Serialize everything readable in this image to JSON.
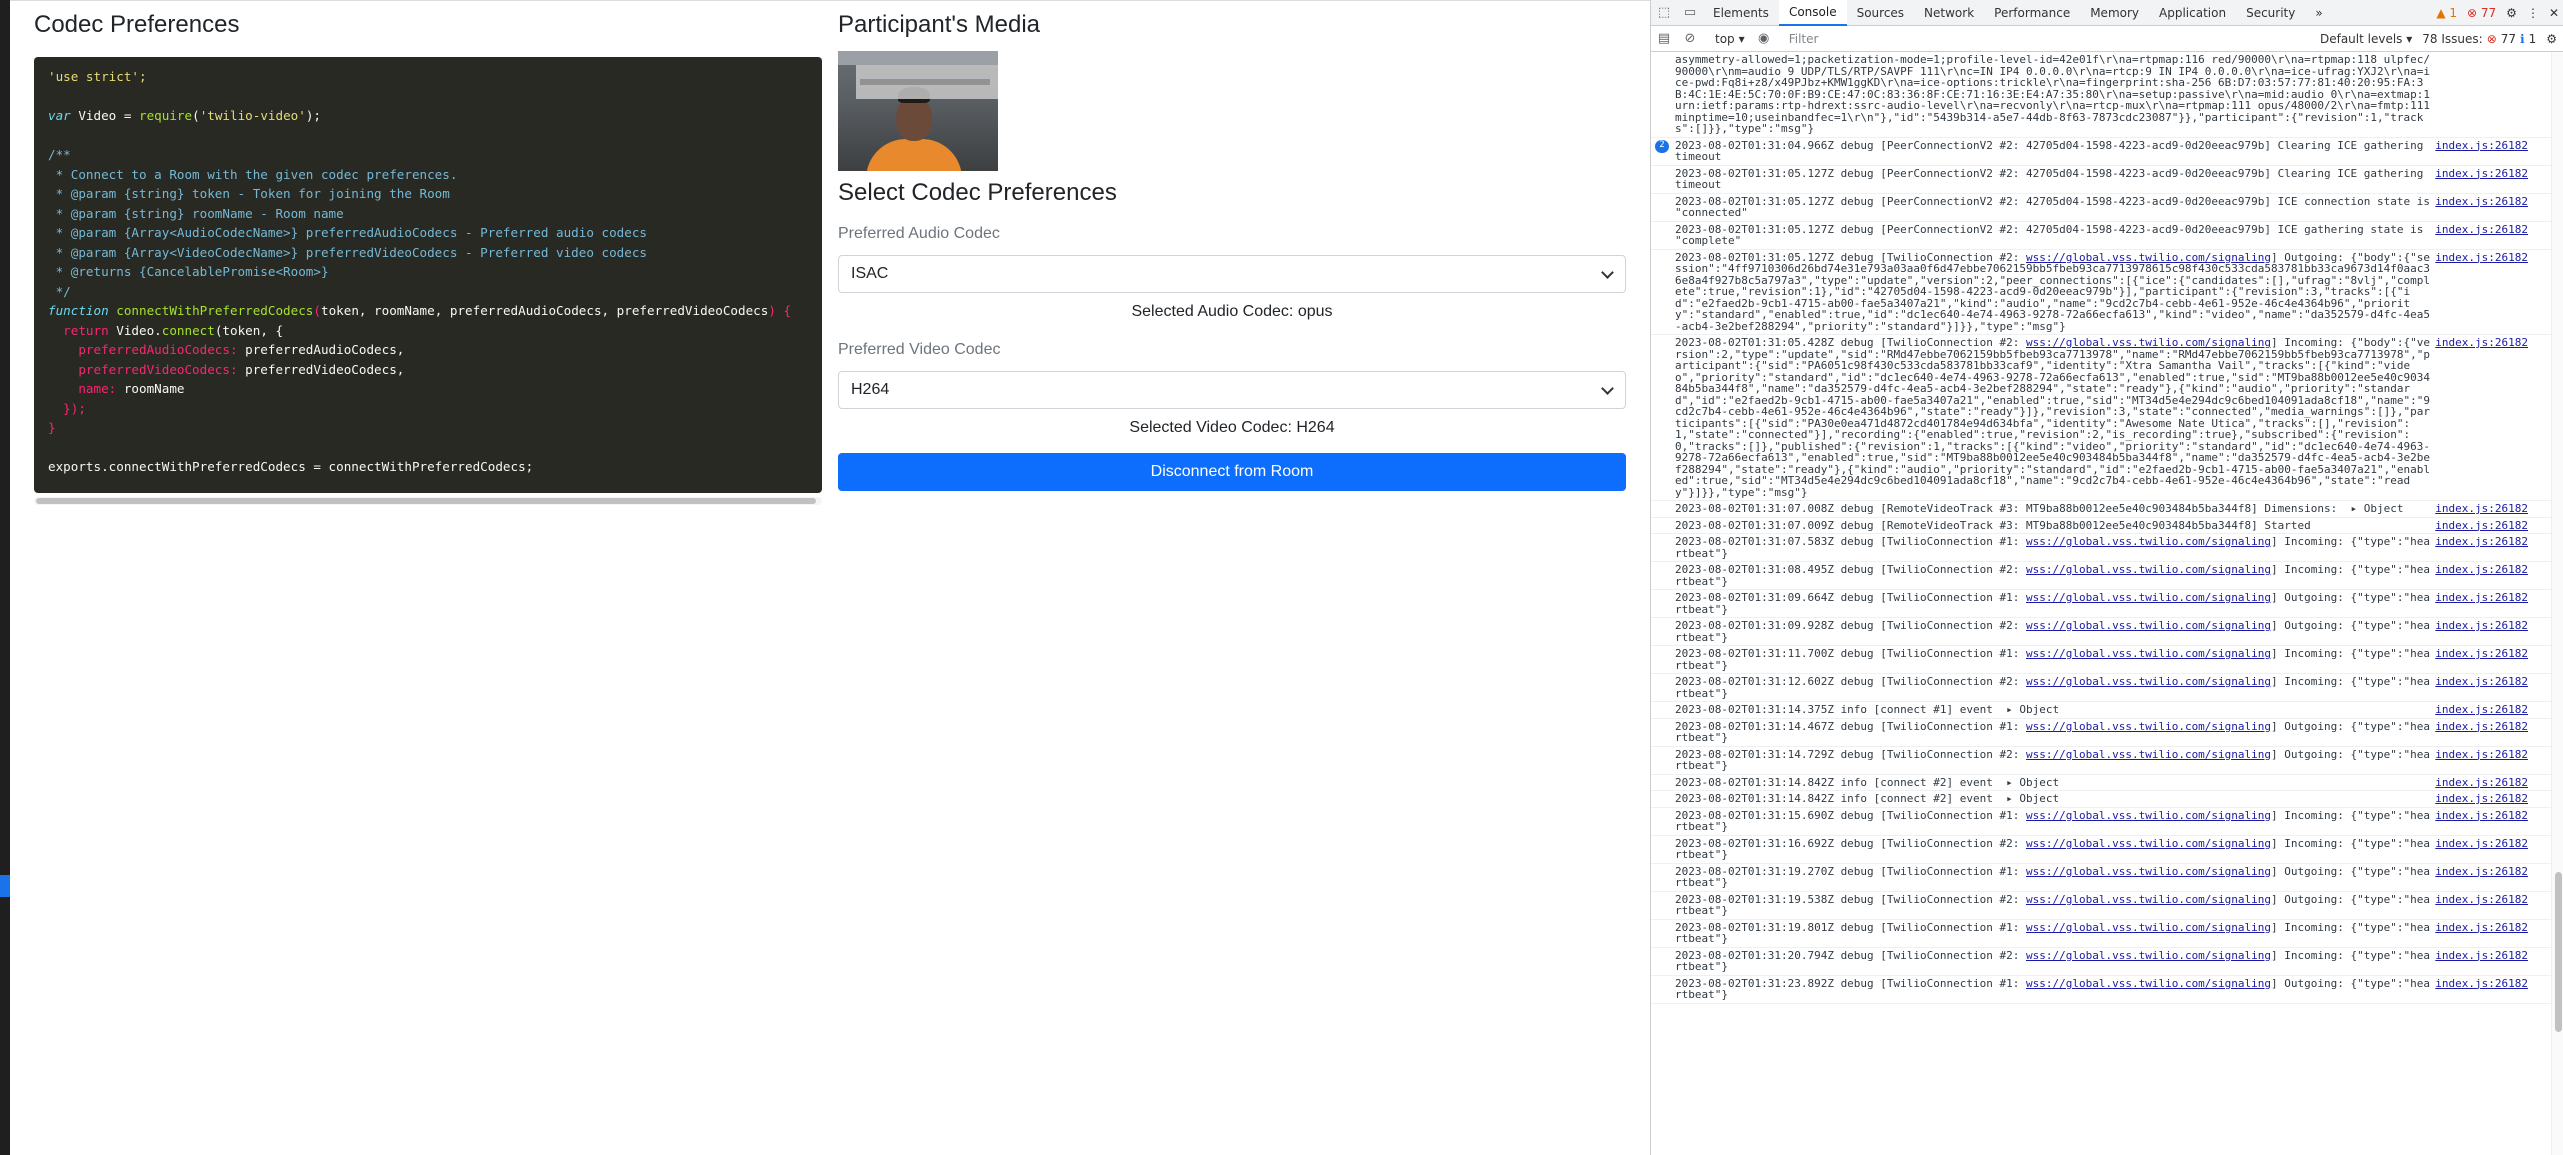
{
  "left_panel": {
    "title": "Codec Preferences",
    "code_lines": [
      [
        {
          "t": "'use strict';",
          "c": "str"
        }
      ],
      [],
      [
        {
          "t": "var ",
          "c": "kw"
        },
        {
          "t": "Video = ",
          "c": "id"
        },
        {
          "t": "require",
          "c": "fn"
        },
        {
          "t": "(",
          "c": "id"
        },
        {
          "t": "'twilio-video'",
          "c": "str"
        },
        {
          "t": ");",
          "c": "id"
        }
      ],
      [],
      [
        {
          "t": "/**",
          "c": "cm"
        }
      ],
      [
        {
          "t": " * Connect to a Room with the given codec preferences.",
          "c": "cm"
        }
      ],
      [
        {
          "t": " * @param {string} token - Token for joining the Room",
          "c": "cm"
        }
      ],
      [
        {
          "t": " * @param {string} roomName - Room name",
          "c": "cm"
        }
      ],
      [
        {
          "t": " * @param {Array<AudioCodecName>} preferredAudioCodecs - Preferred audio codecs",
          "c": "cm"
        }
      ],
      [
        {
          "t": " * @param {Array<VideoCodecName>} preferredVideoCodecs - Preferred video codecs",
          "c": "cm"
        }
      ],
      [
        {
          "t": " * @returns {CancelablePromise<Room>}",
          "c": "cm"
        }
      ],
      [
        {
          "t": " */",
          "c": "cm"
        }
      ],
      [
        {
          "t": "function ",
          "c": "kw"
        },
        {
          "t": "connectWithPreferredCodecs",
          "c": "fn"
        },
        {
          "t": "(",
          "c": "prop"
        },
        {
          "t": "token, roomName, preferredAudioCodecs, preferredVideoCodecs",
          "c": "id"
        },
        {
          "t": ") {",
          "c": "prop"
        }
      ],
      [
        {
          "t": "  return ",
          "c": "kw2"
        },
        {
          "t": "Video.",
          "c": "id"
        },
        {
          "t": "connect",
          "c": "fn"
        },
        {
          "t": "(token, {",
          "c": "id"
        }
      ],
      [
        {
          "t": "    preferredAudioCodecs: ",
          "c": "prop"
        },
        {
          "t": "preferredAudioCodecs,",
          "c": "id"
        }
      ],
      [
        {
          "t": "    preferredVideoCodecs: ",
          "c": "prop"
        },
        {
          "t": "preferredVideoCodecs,",
          "c": "id"
        }
      ],
      [
        {
          "t": "    name: ",
          "c": "prop"
        },
        {
          "t": "roomName",
          "c": "id"
        }
      ],
      [
        {
          "t": "  });",
          "c": "prop"
        }
      ],
      [
        {
          "t": "}",
          "c": "prop"
        }
      ],
      [],
      [
        {
          "t": "exports.connectWithPreferredCodecs = connectWithPreferredCodecs;",
          "c": "id"
        }
      ]
    ]
  },
  "right_panel": {
    "media_title": "Participant's Media",
    "codec_title": "Select Codec Preferences",
    "audio_label": "Preferred Audio Codec",
    "audio_value": "ISAC",
    "selected_audio": "Selected Audio Codec: opus",
    "video_label": "Preferred Video Codec",
    "video_value": "H264",
    "selected_video": "Selected Video Codec: H264",
    "disconnect_label": "Disconnect from Room"
  },
  "devtools": {
    "tabs": [
      "Elements",
      "Console",
      "Sources",
      "Network",
      "Performance",
      "Memory",
      "Application",
      "Security"
    ],
    "active_tab": "Console",
    "more_tabs": "»",
    "warnings_count": "1",
    "errors_count": "77",
    "context": "top",
    "filter_placeholder": "Filter",
    "levels": "Default levels",
    "issues_label": "78 Issues:",
    "issues_errors": "77",
    "issues_info": "1",
    "messages": [
      {
        "text": "asymmetry-allowed=1;packetization-mode=1;profile-level-id=42e01f\\r\\na=rtpmap:116 red/90000\\r\\na=rtpmap:118 ulpfec/90000\\r\\nm=audio 9 UDP/TLS/RTP/SAVPF 111\\r\\nc=IN IP4 0.0.0.0\\r\\na=rtcp:9 IN IP4 0.0.0.0\\r\\na=ice-ufrag:YXJ2\\r\\na=ice-pwd:Fq8i+z8/x49PJbz+KMW1ggKD\\r\\na=ice-options:trickle\\r\\na=fingerprint:sha-256 6B:D7:03:57:77:81:40:20:95:FA:3B:4C:1E:4E:5C:70:0F:B9:CE:47:0C:83:36:8F:CE:71:16:3E:E4:A7:35:80\\r\\na=setup:passive\\r\\na=mid:audio 0\\r\\na=extmap:1 urn:ietf:params:rtp-hdrext:ssrc-audio-level\\r\\na=recvonly\\r\\na=rtcp-mux\\r\\na=rtpmap:111 opus/48000/2\\r\\na=fmtp:111 minptime=10;useinbandfec=1\\r\\n\"},\"id\":\"5439b314-a5e7-44db-8f63-7873cdc23087\"}},\"participant\":{\"revision\":1,\"tracks\":[]}},\"type\":\"msg\"}",
        "src": ""
      },
      {
        "badge": "2",
        "text": "2023-08-02T01:31:04.966Z debug [PeerConnectionV2 #2: 42705d04-1598-4223-acd9-0d20eeac979b] Clearing ICE gathering timeout",
        "src": "index.js:26182"
      },
      {
        "text": "2023-08-02T01:31:05.127Z debug [PeerConnectionV2 #2: 42705d04-1598-4223-acd9-0d20eeac979b] Clearing ICE gathering timeout",
        "src": "index.js:26182"
      },
      {
        "text": "2023-08-02T01:31:05.127Z debug [PeerConnectionV2 #2: 42705d04-1598-4223-acd9-0d20eeac979b] ICE connection state is \"connected\"",
        "src": "index.js:26182"
      },
      {
        "text": "2023-08-02T01:31:05.127Z debug [PeerConnectionV2 #2: 42705d04-1598-4223-acd9-0d20eeac979b] ICE gathering state is \"complete\"",
        "src": "index.js:26182"
      },
      {
        "pre": "2023-08-02T01:31:05.127Z debug [TwilioConnection #2: ",
        "link": "wss://global.vss.twilio.com/signaling",
        "text": "] Outgoing: {\"body\":{\"session\":\"4ff9710306d26bd74e31e793a03aa0f6d47ebbe7062159bb5fbeb93ca7713978615c98f430c533cda583781bb33ca9673d14f0aac36e8a4f927b8c5a797a3\",\"type\":\"update\",\"version\":2,\"peer_connections\":[{\"ice\":{\"candidates\":[],\"ufrag\":\"8vlj\",\"complete\":true,\"revision\":1},\"id\":\"42705d04-1598-4223-acd9-0d20eeac979b\"}],\"participant\":{\"revision\":3,\"tracks\":[{\"id\":\"e2faed2b-9cb1-4715-ab00-fae5a3407a21\",\"kind\":\"audio\",\"name\":\"9cd2c7b4-cebb-4e61-952e-46c4e4364b96\",\"priority\":\"standard\",\"enabled\":true,\"id\":\"dc1ec640-4e74-4963-9278-72a66ecfa613\",\"kind\":\"video\",\"name\":\"da352579-d4fc-4ea5-acb4-3e2bef288294\",\"priority\":\"standard\"}]}},\"type\":\"msg\"}",
        "src": "index.js:26182"
      },
      {
        "pre": "2023-08-02T01:31:05.428Z debug [TwilioConnection #2: ",
        "link": "wss://global.vss.twilio.com/signaling",
        "text": "] Incoming: {\"body\":{\"version\":2,\"type\":\"update\",\"sid\":\"RMd47ebbe7062159bb5fbeb93ca7713978\",\"name\":\"RMd47ebbe7062159bb5fbeb93ca7713978\",\"participant\":{\"sid\":\"PA6051c98f430c533cda583781bb33caf9\",\"identity\":\"Xtra Samantha Vail\",\"tracks\":[{\"kind\":\"video\",\"priority\":\"standard\",\"id\":\"dc1ec640-4e74-4963-9278-72a66ecfa613\",\"enabled\":true,\"sid\":\"MT9ba88b0012ee5e40c903484b5ba344f8\",\"name\":\"da352579-d4fc-4ea5-acb4-3e2bef288294\",\"state\":\"ready\"},{\"kind\":\"audio\",\"priority\":\"standard\",\"id\":\"e2faed2b-9cb1-4715-ab00-fae5a3407a21\",\"enabled\":true,\"sid\":\"MT34d5e4e294dc9c6bed104091ada8cf18\",\"name\":\"9cd2c7b4-cebb-4e61-952e-46c4e4364b96\",\"state\":\"ready\"}]},\"revision\":3,\"state\":\"connected\",\"media_warnings\":[]},\"participants\":[{\"sid\":\"PA30e0ea471d4872cd401784e94d634bfa\",\"identity\":\"Awesome Nate Utica\",\"tracks\":[],\"revision\":1,\"state\":\"connected\"}],\"recording\":{\"enabled\":true,\"revision\":2,\"is_recording\":true},\"subscribed\":{\"revision\":0,\"tracks\":[]},\"published\":{\"revision\":1,\"tracks\":[{\"kind\":\"video\",\"priority\":\"standard\",\"id\":\"dc1ec640-4e74-4963-9278-72a66ecfa613\",\"enabled\":true,\"sid\":\"MT9ba88b0012ee5e40c903484b5ba344f8\",\"name\":\"da352579-d4fc-4ea5-acb4-3e2bef288294\",\"state\":\"ready\"},{\"kind\":\"audio\",\"priority\":\"standard\",\"id\":\"e2faed2b-9cb1-4715-ab00-fae5a3407a21\",\"enabled\":true,\"sid\":\"MT34d5e4e294dc9c6bed104091ada8cf18\",\"name\":\"9cd2c7b4-cebb-4e61-952e-46c4e4364b96\",\"state\":\"ready\"}]}},\"type\":\"msg\"}",
        "src": "index.js:26182"
      },
      {
        "text": "2023-08-02T01:31:07.008Z debug [RemoteVideoTrack #3: MT9ba88b0012ee5e40c903484b5ba344f8] Dimensions:  ▸ Object",
        "src": "index.js:26182"
      },
      {
        "text": "2023-08-02T01:31:07.009Z debug [RemoteVideoTrack #3: MT9ba88b0012ee5e40c903484b5ba344f8] Started",
        "src": "index.js:26182"
      },
      {
        "pre": "2023-08-02T01:31:07.583Z debug [TwilioConnection #1: ",
        "link": "wss://global.vss.twilio.com/signaling",
        "text": "] Incoming: {\"type\":\"heartbeat\"}",
        "src": "index.js:26182"
      },
      {
        "pre": "2023-08-02T01:31:08.495Z debug [TwilioConnection #2: ",
        "link": "wss://global.vss.twilio.com/signaling",
        "text": "] Incoming: {\"type\":\"heartbeat\"}",
        "src": "index.js:26182"
      },
      {
        "pre": "2023-08-02T01:31:09.664Z debug [TwilioConnection #1: ",
        "link": "wss://global.vss.twilio.com/signaling",
        "text": "] Outgoing: {\"type\":\"heartbeat\"}",
        "src": "index.js:26182"
      },
      {
        "pre": "2023-08-02T01:31:09.928Z debug [TwilioConnection #2: ",
        "link": "wss://global.vss.twilio.com/signaling",
        "text": "] Outgoing: {\"type\":\"heartbeat\"}",
        "src": "index.js:26182"
      },
      {
        "pre": "2023-08-02T01:31:11.700Z debug [TwilioConnection #1: ",
        "link": "wss://global.vss.twilio.com/signaling",
        "text": "] Incoming: {\"type\":\"heartbeat\"}",
        "src": "index.js:26182"
      },
      {
        "pre": "2023-08-02T01:31:12.602Z debug [TwilioConnection #2: ",
        "link": "wss://global.vss.twilio.com/signaling",
        "text": "] Incoming: {\"type\":\"heartbeat\"}",
        "src": "index.js:26182"
      },
      {
        "text": "2023-08-02T01:31:14.375Z info [connect #1] event  ▸ Object",
        "src": "index.js:26182"
      },
      {
        "pre": "2023-08-02T01:31:14.467Z debug [TwilioConnection #1: ",
        "link": "wss://global.vss.twilio.com/signaling",
        "text": "] Outgoing: {\"type\":\"heartbeat\"}",
        "src": "index.js:26182"
      },
      {
        "pre": "2023-08-02T01:31:14.729Z debug [TwilioConnection #2: ",
        "link": "wss://global.vss.twilio.com/signaling",
        "text": "] Outgoing: {\"type\":\"heartbeat\"}",
        "src": "index.js:26182"
      },
      {
        "text": "2023-08-02T01:31:14.842Z info [connect #2] event  ▸ Object",
        "src": "index.js:26182"
      },
      {
        "text": "2023-08-02T01:31:14.842Z info [connect #2] event  ▸ Object",
        "src": "index.js:26182"
      },
      {
        "pre": "2023-08-02T01:31:15.690Z debug [TwilioConnection #1: ",
        "link": "wss://global.vss.twilio.com/signaling",
        "text": "] Incoming: {\"type\":\"heartbeat\"}",
        "src": "index.js:26182"
      },
      {
        "pre": "2023-08-02T01:31:16.692Z debug [TwilioConnection #2: ",
        "link": "wss://global.vss.twilio.com/signaling",
        "text": "] Incoming: {\"type\":\"heartbeat\"}",
        "src": "index.js:26182"
      },
      {
        "pre": "2023-08-02T01:31:19.270Z debug [TwilioConnection #1: ",
        "link": "wss://global.vss.twilio.com/signaling",
        "text": "] Outgoing: {\"type\":\"heartbeat\"}",
        "src": "index.js:26182"
      },
      {
        "pre": "2023-08-02T01:31:19.538Z debug [TwilioConnection #2: ",
        "link": "wss://global.vss.twilio.com/signaling",
        "text": "] Outgoing: {\"type\":\"heartbeat\"}",
        "src": "index.js:26182"
      },
      {
        "pre": "2023-08-02T01:31:19.801Z debug [TwilioConnection #1: ",
        "link": "wss://global.vss.twilio.com/signaling",
        "text": "] Incoming: {\"type\":\"heartbeat\"}",
        "src": "index.js:26182"
      },
      {
        "pre": "2023-08-02T01:31:20.794Z debug [TwilioConnection #2: ",
        "link": "wss://global.vss.twilio.com/signaling",
        "text": "] Incoming: {\"type\":\"heartbeat\"}",
        "src": "index.js:26182"
      },
      {
        "pre": "2023-08-02T01:31:23.892Z debug [TwilioConnection #1: ",
        "link": "wss://global.vss.twilio.com/signaling",
        "text": "] Outgoing: {\"type\":\"heartbeat\"}",
        "src": "index.js:26182"
      }
    ]
  }
}
